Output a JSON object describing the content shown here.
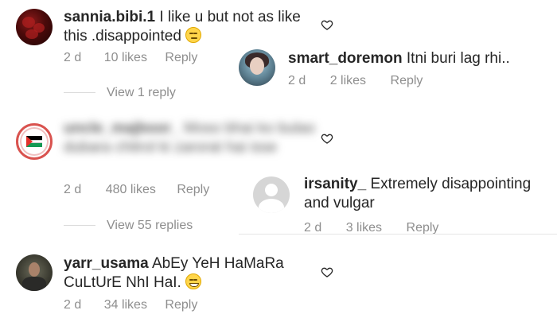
{
  "comments": [
    {
      "username": "sannia.bibi.1",
      "text": "I like u but not as like this .disappointed",
      "emoji": "pensive-face-emoji",
      "time": "2 d",
      "likes": "10 likes",
      "reply_label": "Reply",
      "view_replies": "View 1 reply",
      "reply": {
        "username": "smart_doremon",
        "text": "Itni buri lag rhi..",
        "time": "2 d",
        "likes": "2 likes",
        "reply_label": "Reply"
      }
    },
    {
      "username": "uncle_majboor_",
      "text": "Moso bhai ko bulao dubara chitrol ki zarorat hai isse",
      "time": "2 d",
      "likes": "480 likes",
      "reply_label": "Reply",
      "view_replies": "View 55 replies",
      "reply": {
        "username": "irsanity_",
        "text": "Extremely disappointing and vulgar",
        "time": "2 d",
        "likes": "3 likes",
        "reply_label": "Reply"
      }
    },
    {
      "username": "yarr_usama",
      "text": "AbEy YeH HaMaRa CuLtUrE NhI HaI.",
      "emoji": "grinning-face-emoji",
      "time": "2 d",
      "likes": "34 likes",
      "reply_label": "Reply"
    }
  ],
  "icons": {
    "like": "heart-outline-icon"
  },
  "colors": {
    "text": "#262626",
    "meta": "#8e8e8e",
    "divider": "#dbdbdb"
  }
}
